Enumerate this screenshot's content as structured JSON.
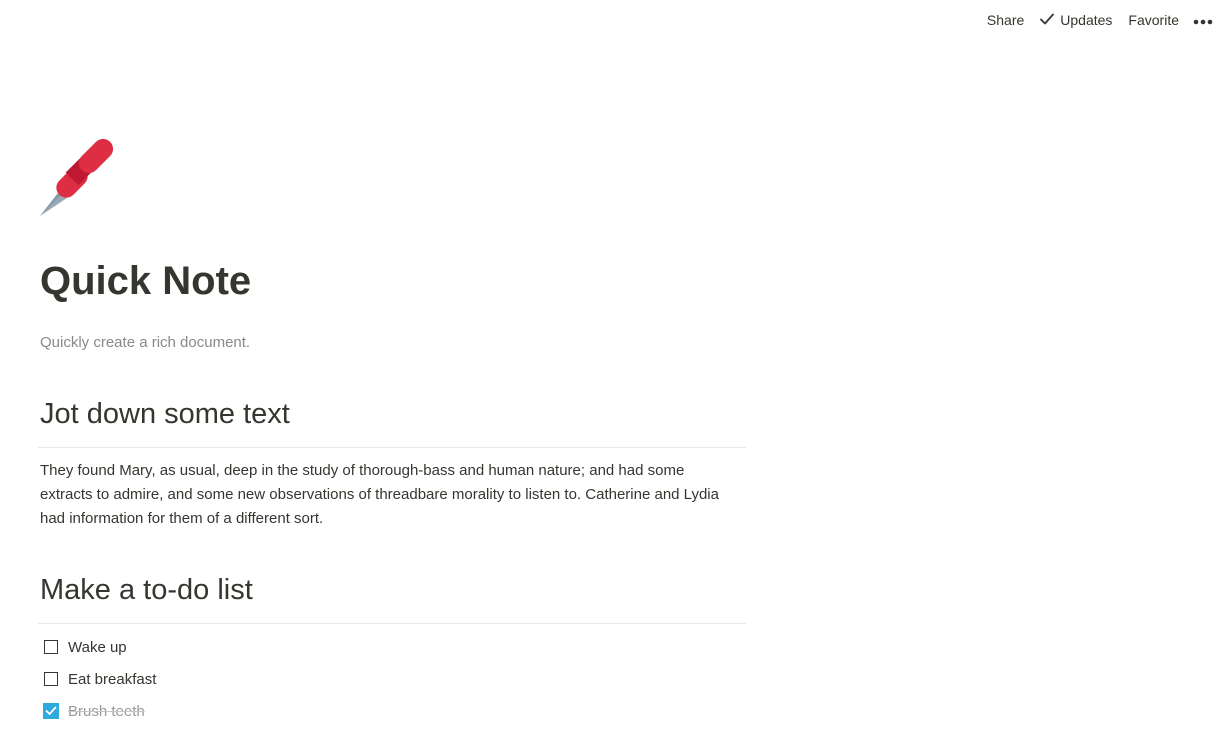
{
  "topbar": {
    "share_label": "Share",
    "updates_label": "Updates",
    "favorite_label": "Favorite",
    "more_icon": "more-horizontal-icon"
  },
  "page": {
    "icon": "pushpin-icon",
    "title": "Quick Note",
    "description": "Quickly create a rich document."
  },
  "sections": [
    {
      "heading": "Jot down some text",
      "paragraph": "They found Mary, as usual, deep in the study of thorough-bass and human nature; and had some extracts to admire, and some new observations of threadbare morality to listen to. Catherine and Lydia had information for them of a different sort."
    },
    {
      "heading": "Make a to-do list",
      "todos": [
        {
          "label": "Wake up",
          "checked": false
        },
        {
          "label": "Eat breakfast",
          "checked": false
        },
        {
          "label": "Brush teeth",
          "checked": true
        }
      ]
    }
  ],
  "colors": {
    "text": "#37352f",
    "muted": "#8a8984",
    "checkbox_checked": "#2eaadc",
    "pin_red": "#dd2e44"
  }
}
